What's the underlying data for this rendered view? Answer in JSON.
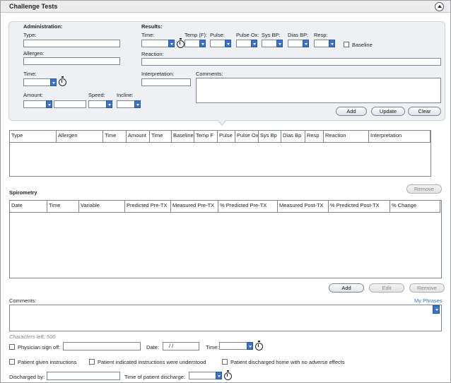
{
  "window": {
    "title": "Challenge Tests"
  },
  "administration": {
    "header": "Administration:",
    "type_label": "Type:",
    "allergen_label": "Allergen:",
    "time_label": "Time:",
    "amount_label": "Amount:",
    "speed_label": "Speed:",
    "incline_label": "Incline:"
  },
  "results": {
    "header": "Results:",
    "time_label": "Time:",
    "temp_label": "Temp (F):",
    "pulse_label": "Pulse:",
    "pulse_ox_label": "Pulse Ox:",
    "sys_bp_label": "Sys BP:",
    "dias_bp_label": "Dias BP:",
    "resp_label": "Resp:",
    "baseline_label": "Baseline",
    "reaction_label": "Reaction:",
    "interpretation_label": "Interpretation:",
    "comments_label": "Comments:"
  },
  "results_buttons": {
    "add": "Add",
    "update": "Update",
    "clear": "Clear"
  },
  "results_table": {
    "columns": [
      "Type",
      "Allergen",
      "Time",
      "Amount",
      "Time",
      "Baseline",
      "Temp F",
      "Pulse",
      "Pulse Ox",
      "Sys Bp",
      "Dias Bp",
      "Resp",
      "Reaction",
      "Interpretation"
    ]
  },
  "spirometry": {
    "title": "Spirometry",
    "remove_top": "Remove",
    "columns": [
      "Date",
      "Time",
      "Variable",
      "Predicted Pre-TX",
      "Measured Pre-TX",
      "% Predicted Pre-TX",
      "Measured Post-TX",
      "% Predicted Post-TX",
      "% Change"
    ],
    "buttons": {
      "add": "Add",
      "edit": "Edit",
      "remove": "Remove"
    }
  },
  "comments": {
    "label": "Comments:",
    "my_phrases": "My Phrases",
    "chars_left": "Characters left: 500"
  },
  "signoff": {
    "physician_label": "Physician sign off:",
    "date_label": "Date:",
    "date_value": " / /",
    "time_label": "Time:"
  },
  "checks": {
    "instructions_given": "Patient given instructions",
    "instructions_understood": "Patient indicated instructions were understood",
    "discharged_home": "Patient discharged home with no adverse effects"
  },
  "discharge": {
    "by_label": "Discharged by:",
    "time_label": "Time of patient discharge:"
  }
}
